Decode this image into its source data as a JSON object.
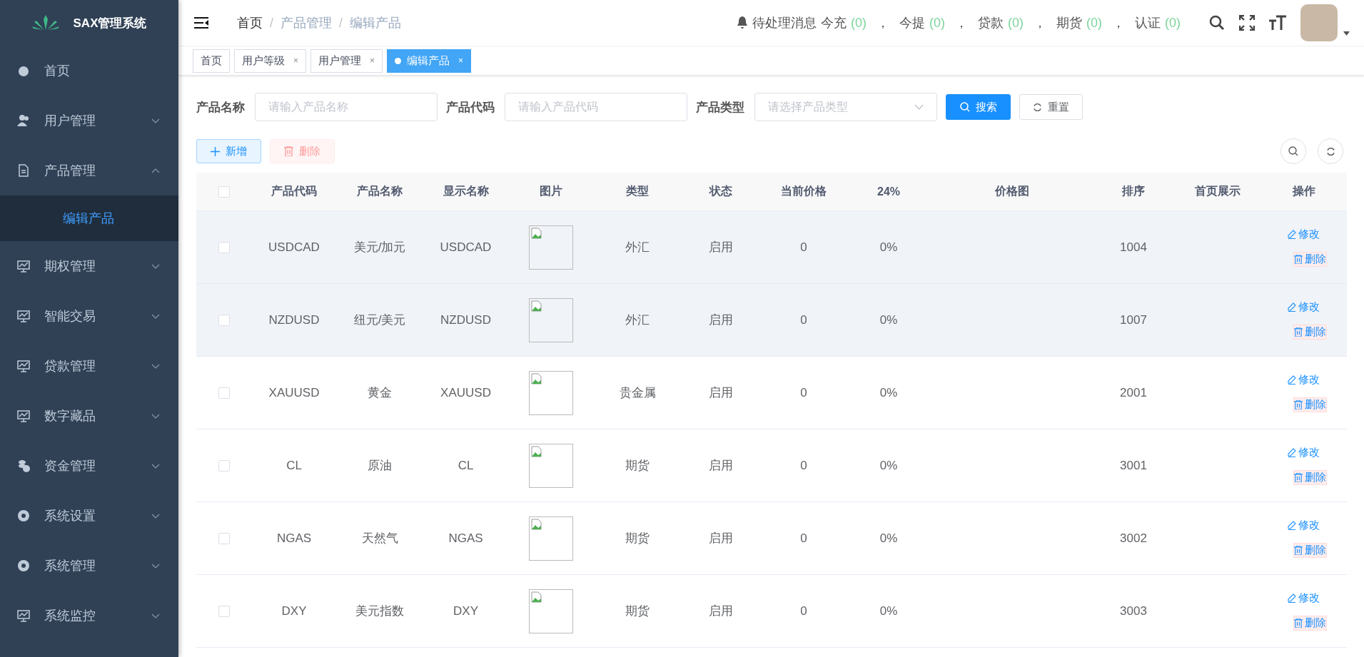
{
  "sidebar": {
    "logo": "SAX管理系统",
    "items": [
      {
        "label": "首页",
        "expandable": false
      },
      {
        "label": "用户管理",
        "expandable": true,
        "expanded": false
      },
      {
        "label": "产品管理",
        "expandable": true,
        "expanded": true,
        "children": [
          {
            "label": "编辑产品",
            "selected": true
          }
        ]
      },
      {
        "label": "期权管理",
        "expandable": true,
        "expanded": false
      },
      {
        "label": "智能交易",
        "expandable": true,
        "expanded": false
      },
      {
        "label": "贷款管理",
        "expandable": true,
        "expanded": false
      },
      {
        "label": "数字藏品",
        "expandable": true,
        "expanded": false
      },
      {
        "label": "资金管理",
        "expandable": true,
        "expanded": false
      },
      {
        "label": "系统设置",
        "expandable": true,
        "expanded": false
      },
      {
        "label": "系统管理",
        "expandable": true,
        "expanded": false
      },
      {
        "label": "系统监控",
        "expandable": true,
        "expanded": false
      }
    ]
  },
  "header": {
    "breadcrumb": [
      "首页",
      "产品管理",
      "编辑产品"
    ],
    "breadcrumb_separator": "/",
    "notices": {
      "title": "待处理消息",
      "separator": "，",
      "items": [
        {
          "label": "今充",
          "count": "(0)"
        },
        {
          "label": "今提",
          "count": "(0)"
        },
        {
          "label": "贷款",
          "count": "(0)"
        },
        {
          "label": "期货",
          "count": "(0)"
        },
        {
          "label": "认证",
          "count": "(0)"
        }
      ]
    }
  },
  "tags": {
    "close_glyph": "×",
    "items": [
      {
        "label": "首页",
        "selected": false,
        "closable": false
      },
      {
        "label": "用户等级",
        "selected": false,
        "closable": true
      },
      {
        "label": "用户管理",
        "selected": false,
        "closable": true
      },
      {
        "label": "编辑产品",
        "selected": true,
        "closable": true
      }
    ]
  },
  "filters": [
    {
      "kind": "input",
      "label": "产品名称",
      "placeholder": "请输入产品名称"
    },
    {
      "kind": "input",
      "label": "产品代码",
      "placeholder": "请输入产品代码"
    },
    {
      "kind": "select",
      "label": "产品类型",
      "placeholder": "请选择产品类型"
    }
  ],
  "search_button": "搜索",
  "reset_button": "重置",
  "actions": {
    "add": {
      "label": "新增",
      "disabled": false
    },
    "delete": {
      "label": "删除",
      "disabled": true
    }
  },
  "table": {
    "all_checked": false,
    "columns": [
      "产品代码",
      "产品名称",
      "显示名称",
      "图片",
      "类型",
      "状态",
      "当前价格",
      "24%",
      "价格图",
      "排序",
      "首页展示",
      "操作"
    ],
    "rows": [
      {
        "checked": false,
        "highlighted": true,
        "code": "USDCAD",
        "name": "美元/加元",
        "display": "USDCAD",
        "type": "外汇",
        "status": "启用",
        "price": "0",
        "change": "0%",
        "sort": "1004",
        "edit": "修改",
        "delete": "删除"
      },
      {
        "checked": false,
        "highlighted": true,
        "code": "NZDUSD",
        "name": "纽元/美元",
        "display": "NZDUSD",
        "type": "外汇",
        "status": "启用",
        "price": "0",
        "change": "0%",
        "sort": "1007",
        "edit": "修改",
        "delete": "删除"
      },
      {
        "checked": false,
        "highlighted": false,
        "code": "XAUUSD",
        "name": "黄金",
        "display": "XAUUSD",
        "type": "贵金属",
        "status": "启用",
        "price": "0",
        "change": "0%",
        "sort": "2001",
        "edit": "修改",
        "delete": "删除"
      },
      {
        "checked": false,
        "highlighted": false,
        "code": "CL",
        "name": "原油",
        "display": "CL",
        "type": "期货",
        "status": "启用",
        "price": "0",
        "change": "0%",
        "sort": "3001",
        "edit": "修改",
        "delete": "删除"
      },
      {
        "checked": false,
        "highlighted": false,
        "code": "NGAS",
        "name": "天然气",
        "display": "NGAS",
        "type": "期货",
        "status": "启用",
        "price": "0",
        "change": "0%",
        "sort": "3002",
        "edit": "修改",
        "delete": "删除"
      },
      {
        "checked": false,
        "highlighted": false,
        "code": "DXY",
        "name": "美元指数",
        "display": "DXY",
        "type": "期货",
        "status": "启用",
        "price": "0",
        "change": "0%",
        "sort": "3003",
        "edit": "修改",
        "delete": "删除"
      }
    ]
  }
}
